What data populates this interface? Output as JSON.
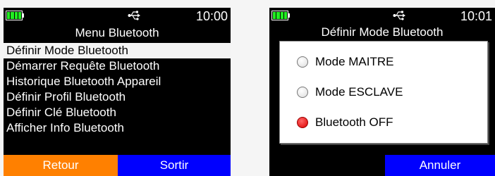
{
  "screen_menu": {
    "status": {
      "battery_icon": "battery-full-icon",
      "usb_icon": "usb-icon",
      "time": "10:00"
    },
    "title": "Menu Bluetooth",
    "items": [
      {
        "label": "Définir Mode Bluetooth",
        "selected": true
      },
      {
        "label": "Démarrer Requête Bluetooth",
        "selected": false
      },
      {
        "label": "Historique Bluetooth Appareil",
        "selected": false
      },
      {
        "label": "Définir Profil Bluetooth",
        "selected": false
      },
      {
        "label": "Définir Clé Bluetooth",
        "selected": false
      },
      {
        "label": "Afficher Info Bluetooth",
        "selected": false
      }
    ],
    "softkeys": {
      "left": "Retour",
      "right": "Sortir"
    }
  },
  "screen_mode": {
    "status": {
      "battery_icon": "battery-full-icon",
      "usb_icon": "usb-icon",
      "time": "10:01"
    },
    "title": "Définir Mode Bluetooth",
    "options": [
      {
        "label": "Mode MAITRE",
        "selected": false
      },
      {
        "label": "Mode ESCLAVE",
        "selected": false
      },
      {
        "label": "Bluetooth OFF",
        "selected": true
      }
    ],
    "softkeys": {
      "right": "Annuler"
    }
  },
  "colors": {
    "background": "#000000",
    "battery": "#22ee22",
    "selection": "#f4f4f4",
    "softkey_orange": "#ff8000",
    "softkey_blue": "#0000ff",
    "radio_selected": "#dd0000"
  }
}
